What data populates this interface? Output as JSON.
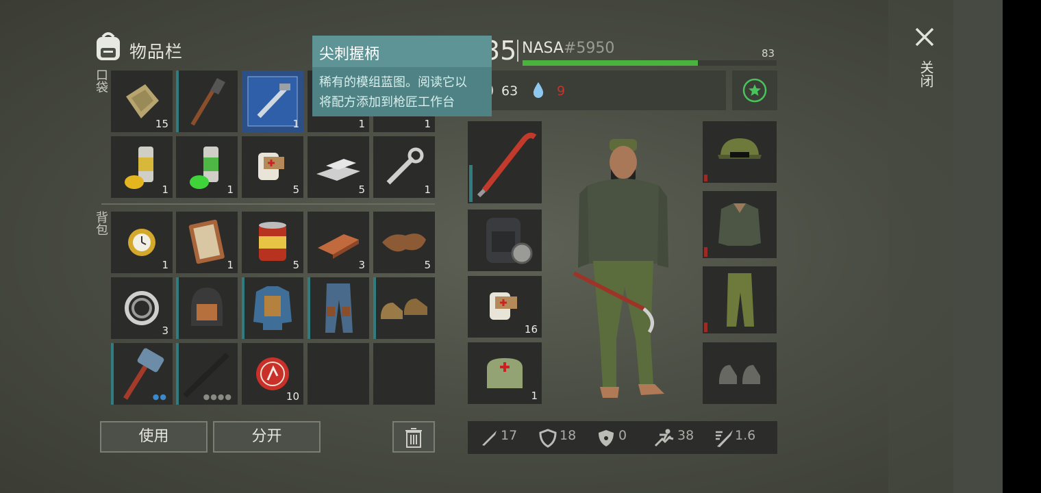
{
  "header": {
    "title": "物品栏",
    "level_partial": "35",
    "player_name": "NASA",
    "player_tag": "#5950",
    "health_value": "83",
    "health_fraction": 0.69,
    "food_value": "63",
    "water_value": "9",
    "close_label": "关闭"
  },
  "tooltip": {
    "title": "尖刺握柄",
    "line1": "稀有的模组蓝图。阅读它以",
    "line2": "将配方添加到枪匠工作台"
  },
  "sections": {
    "pockets_label": "口袋",
    "backpack_label": "背包"
  },
  "pocket_items": [
    {
      "name": "rag-cloth",
      "count": "15"
    },
    {
      "name": "shovel",
      "count": ""
    },
    {
      "name": "blueprint",
      "count": "1"
    },
    {
      "name": "hidden-item",
      "count": "1"
    },
    {
      "name": "hidden-item",
      "count": "1"
    },
    {
      "name": "yellow-spray-paint",
      "count": "1"
    },
    {
      "name": "green-spray-paint",
      "count": "1"
    },
    {
      "name": "bandage",
      "count": "5"
    },
    {
      "name": "metal-bars",
      "count": "5"
    },
    {
      "name": "wrench",
      "count": "1"
    }
  ],
  "backpack_items": [
    {
      "name": "gold-watch",
      "count": "1"
    },
    {
      "name": "diary",
      "count": "1"
    },
    {
      "name": "canned-food",
      "count": "5"
    },
    {
      "name": "copper-ingot",
      "count": "3"
    },
    {
      "name": "leather",
      "count": "5"
    },
    {
      "name": "bearing",
      "count": "3"
    },
    {
      "name": "helmet",
      "count": ""
    },
    {
      "name": "armored-jacket",
      "count": ""
    },
    {
      "name": "armored-pants",
      "count": ""
    },
    {
      "name": "boots",
      "count": ""
    },
    {
      "name": "sledgehammer",
      "count": ""
    },
    {
      "name": "assault-rifle",
      "count": ""
    },
    {
      "name": "bottle-cap",
      "count": "10"
    },
    {
      "name": "empty",
      "count": ""
    },
    {
      "name": "empty",
      "count": ""
    }
  ],
  "equip_left": [
    {
      "name": "crowbar",
      "count": ""
    },
    {
      "name": "backpack",
      "count": ""
    },
    {
      "name": "bandage",
      "count": "16"
    },
    {
      "name": "first-aid-bag",
      "count": "1"
    }
  ],
  "equip_right": [
    {
      "name": "camo-cap"
    },
    {
      "name": "bomber-jacket"
    },
    {
      "name": "camo-pants"
    },
    {
      "name": "empty-boots-slot"
    }
  ],
  "buttons": {
    "use": "使用",
    "split": "分开"
  },
  "stats": {
    "attack": "17",
    "defense": "18",
    "radiation": "0",
    "speed": "38",
    "attack_speed": "1.6"
  },
  "colors": {
    "health": "#4ab33e",
    "water_low": "#c9332a",
    "tooltip": "#4f8284",
    "slot": "#2b2c29"
  }
}
